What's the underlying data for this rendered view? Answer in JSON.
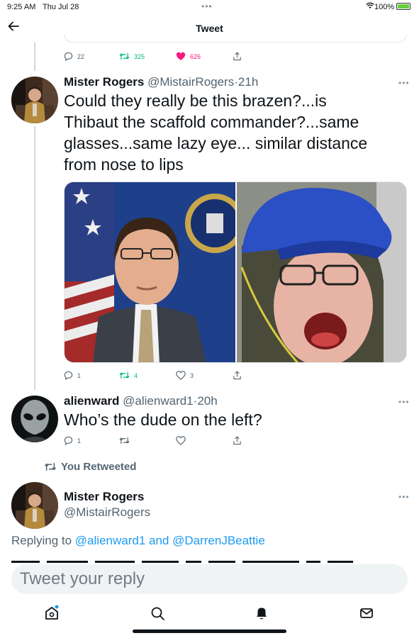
{
  "status_bar": {
    "time": "9:25 AM",
    "date": "Thu Jul 28",
    "battery": "100%"
  },
  "header": {
    "title": "Tweet"
  },
  "prev_tweet_actions": {
    "replies": "22",
    "retweets": "325",
    "likes": "626"
  },
  "tweet1": {
    "name": "Mister Rogers",
    "handle": "@MistairRogers",
    "sep": "·",
    "time": "21h",
    "text_lines": [
      "Could they really be this brazen?...is",
      "Thibaut the scaffold commander?...same",
      "glasses...same lazy eye... similar distance",
      "from nose to lips"
    ],
    "replies": "1",
    "retweets": "4",
    "likes": "3"
  },
  "tweet2": {
    "name": "alienward",
    "handle": "@alienward1",
    "sep": "·",
    "time": "20h",
    "text": "Who’s the dude on the left?",
    "replies": "1"
  },
  "retweeted_label": "You Retweeted",
  "tweet3": {
    "name": "Mister Rogers",
    "handle": "@MistairRogers"
  },
  "replying": {
    "prefix": "Replying to",
    "user1": "@alienward1",
    "joiner": "and",
    "user2": "@DarrenJBeattie"
  },
  "composer": {
    "placeholder": "Tweet your reply"
  },
  "colors": {
    "like": "#f91880",
    "retweet": "#00ba7c",
    "link": "#1d9bf0",
    "muted": "#536471"
  },
  "icons": [
    "back-arrow-icon",
    "reply-icon",
    "retweet-icon",
    "heart-icon",
    "share-icon",
    "more-icon",
    "home-icon",
    "search-icon",
    "notifications-icon",
    "messages-icon",
    "wifi-icon",
    "battery-icon"
  ]
}
